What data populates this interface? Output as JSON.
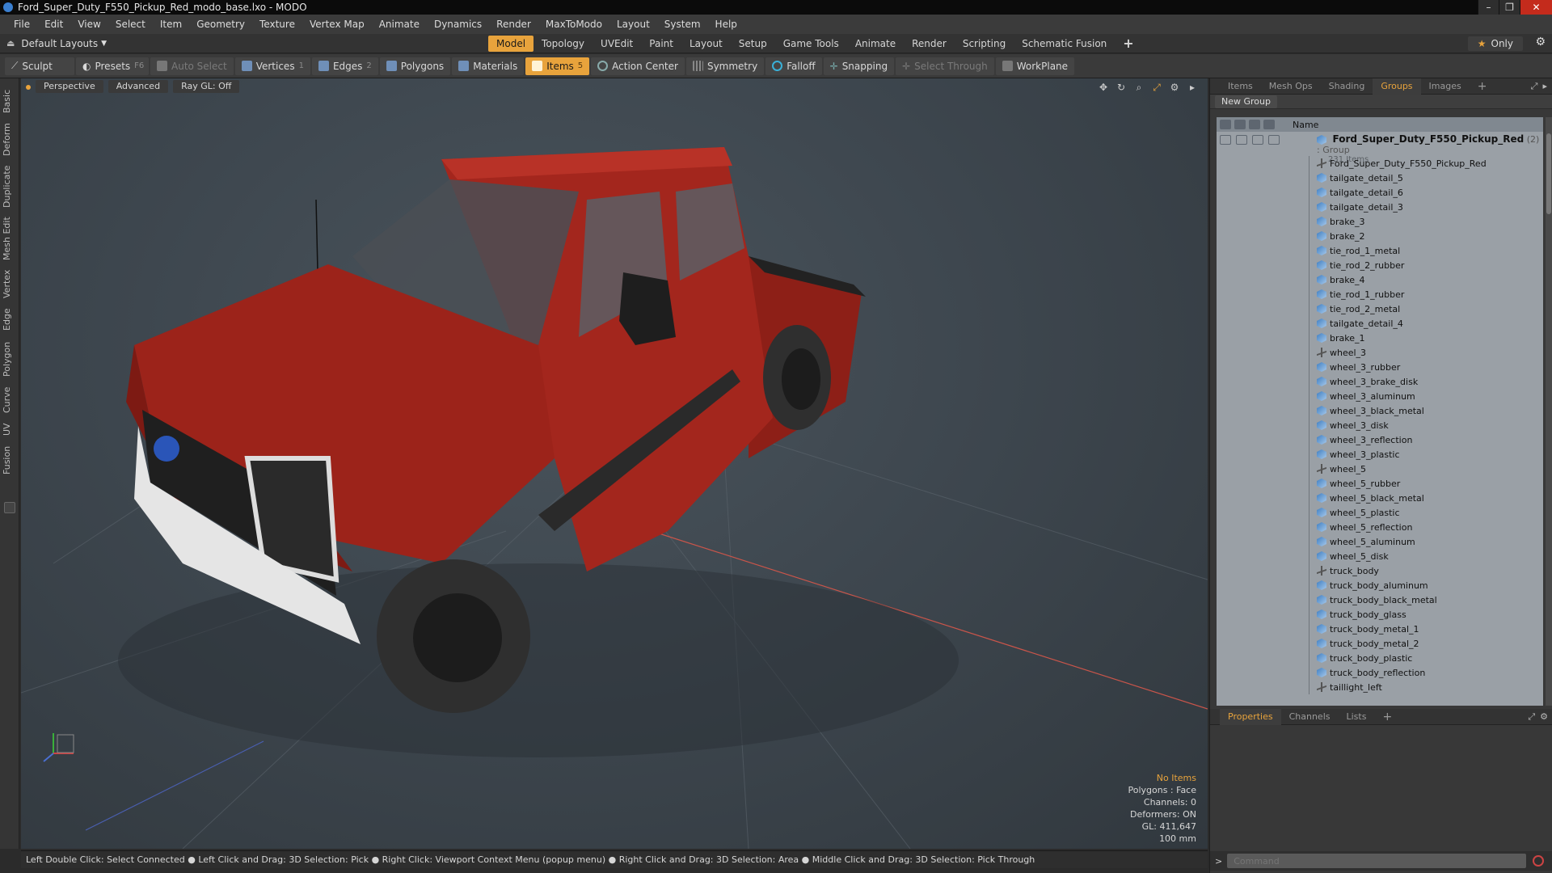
{
  "window": {
    "title": "Ford_Super_Duty_F550_Pickup_Red_modo_base.lxo - MODO",
    "controls": [
      "–",
      "❐",
      "✕"
    ]
  },
  "menubar": [
    "File",
    "Edit",
    "View",
    "Select",
    "Item",
    "Geometry",
    "Texture",
    "Vertex Map",
    "Animate",
    "Dynamics",
    "Render",
    "MaxToModo",
    "Layout",
    "System",
    "Help"
  ],
  "layoutbar": {
    "layout_label": "Default Layouts",
    "tabs": [
      "Model",
      "Topology",
      "UVEdit",
      "Paint",
      "Layout",
      "Setup",
      "Game Tools",
      "Animate",
      "Render",
      "Scripting",
      "Schematic Fusion",
      "+"
    ],
    "active_tab": "Model",
    "only_label": "Only"
  },
  "toolbar": {
    "sculpt": "Sculpt",
    "presets": "Presets",
    "presets_key": "F6",
    "auto_select": "Auto Select",
    "vertices": "Vertices",
    "vertices_count": "1",
    "edges": "Edges",
    "edges_count": "2",
    "polygons": "Polygons",
    "materials": "Materials",
    "items": "Items",
    "items_count": "5",
    "action_center": "Action Center",
    "symmetry": "Symmetry",
    "falloff": "Falloff",
    "snapping": "Snapping",
    "select_through": "Select Through",
    "workplane": "WorkPlane"
  },
  "left_tabs": [
    "Basic",
    "Deform",
    "Duplicate",
    "Mesh Edit",
    "Vertex",
    "Edge",
    "Polygon",
    "Curve",
    "UV",
    "Fusion"
  ],
  "viewport": {
    "view_mode": "Perspective",
    "shading": "Advanced",
    "raygl": "Ray GL: Off",
    "info": {
      "items": "No Items",
      "polygons": "Polygons : Face",
      "channels": "Channels: 0",
      "deformers": "Deformers: ON",
      "gl": "GL: 411,647",
      "scale": "100 mm"
    }
  },
  "statusbar": "Left Double Click: Select Connected ● Left Click and Drag: 3D Selection: Pick ● Right Click: Viewport Context Menu (popup menu) ● Right Click and Drag: 3D Selection: Area ● Middle Click and Drag: 3D Selection: Pick Through",
  "panel_top": {
    "tabs": [
      "Items",
      "Mesh Ops",
      "Shading",
      "Groups",
      "Images",
      "+"
    ],
    "active_tab": "Groups",
    "new_group": "New Group",
    "column_name": "Name",
    "group": {
      "name": "Ford_Super_Duty_F550_Pickup_Red",
      "meta": "(2) : Group",
      "sub": "231 Items"
    },
    "items": [
      {
        "name": "Ford_Super_Duty_F550_Pickup_Red",
        "icon": "locator-icon"
      },
      {
        "name": "tailgate_detail_5",
        "icon": "mesh-icon"
      },
      {
        "name": "tailgate_detail_6",
        "icon": "mesh-icon"
      },
      {
        "name": "tailgate_detail_3",
        "icon": "mesh-icon"
      },
      {
        "name": "brake_3",
        "icon": "mesh-icon"
      },
      {
        "name": "brake_2",
        "icon": "mesh-icon"
      },
      {
        "name": "tie_rod_1_metal",
        "icon": "mesh-icon"
      },
      {
        "name": "tie_rod_2_rubber",
        "icon": "mesh-icon"
      },
      {
        "name": "brake_4",
        "icon": "mesh-icon"
      },
      {
        "name": "tie_rod_1_rubber",
        "icon": "mesh-icon"
      },
      {
        "name": "tie_rod_2_metal",
        "icon": "mesh-icon"
      },
      {
        "name": "tailgate_detail_4",
        "icon": "mesh-icon"
      },
      {
        "name": "brake_1",
        "icon": "mesh-icon"
      },
      {
        "name": "wheel_3",
        "icon": "locator-icon"
      },
      {
        "name": "wheel_3_rubber",
        "icon": "mesh-icon"
      },
      {
        "name": "wheel_3_brake_disk",
        "icon": "mesh-icon"
      },
      {
        "name": "wheel_3_aluminum",
        "icon": "mesh-icon"
      },
      {
        "name": "wheel_3_black_metal",
        "icon": "mesh-icon"
      },
      {
        "name": "wheel_3_disk",
        "icon": "mesh-icon"
      },
      {
        "name": "wheel_3_reflection",
        "icon": "mesh-icon"
      },
      {
        "name": "wheel_3_plastic",
        "icon": "mesh-icon"
      },
      {
        "name": "wheel_5",
        "icon": "locator-icon"
      },
      {
        "name": "wheel_5_rubber",
        "icon": "mesh-icon"
      },
      {
        "name": "wheel_5_black_metal",
        "icon": "mesh-icon"
      },
      {
        "name": "wheel_5_plastic",
        "icon": "mesh-icon"
      },
      {
        "name": "wheel_5_reflection",
        "icon": "mesh-icon"
      },
      {
        "name": "wheel_5_aluminum",
        "icon": "mesh-icon"
      },
      {
        "name": "wheel_5_disk",
        "icon": "mesh-icon"
      },
      {
        "name": "truck_body",
        "icon": "locator-icon"
      },
      {
        "name": "truck_body_aluminum",
        "icon": "mesh-icon"
      },
      {
        "name": "truck_body_black_metal",
        "icon": "mesh-icon"
      },
      {
        "name": "truck_body_glass",
        "icon": "mesh-icon"
      },
      {
        "name": "truck_body_metal_1",
        "icon": "mesh-icon"
      },
      {
        "name": "truck_body_metal_2",
        "icon": "mesh-icon"
      },
      {
        "name": "truck_body_plastic",
        "icon": "mesh-icon"
      },
      {
        "name": "truck_body_reflection",
        "icon": "mesh-icon"
      },
      {
        "name": "taillight_left",
        "icon": "locator-icon"
      }
    ]
  },
  "panel_bottom": {
    "tabs": [
      "Properties",
      "Channels",
      "Lists",
      "+"
    ],
    "active_tab": "Properties"
  },
  "command": {
    "placeholder": "Command"
  },
  "colors": {
    "accent": "#e8a33c",
    "truck_red": "#a3261d",
    "viewport_bg": "#3e474f"
  }
}
